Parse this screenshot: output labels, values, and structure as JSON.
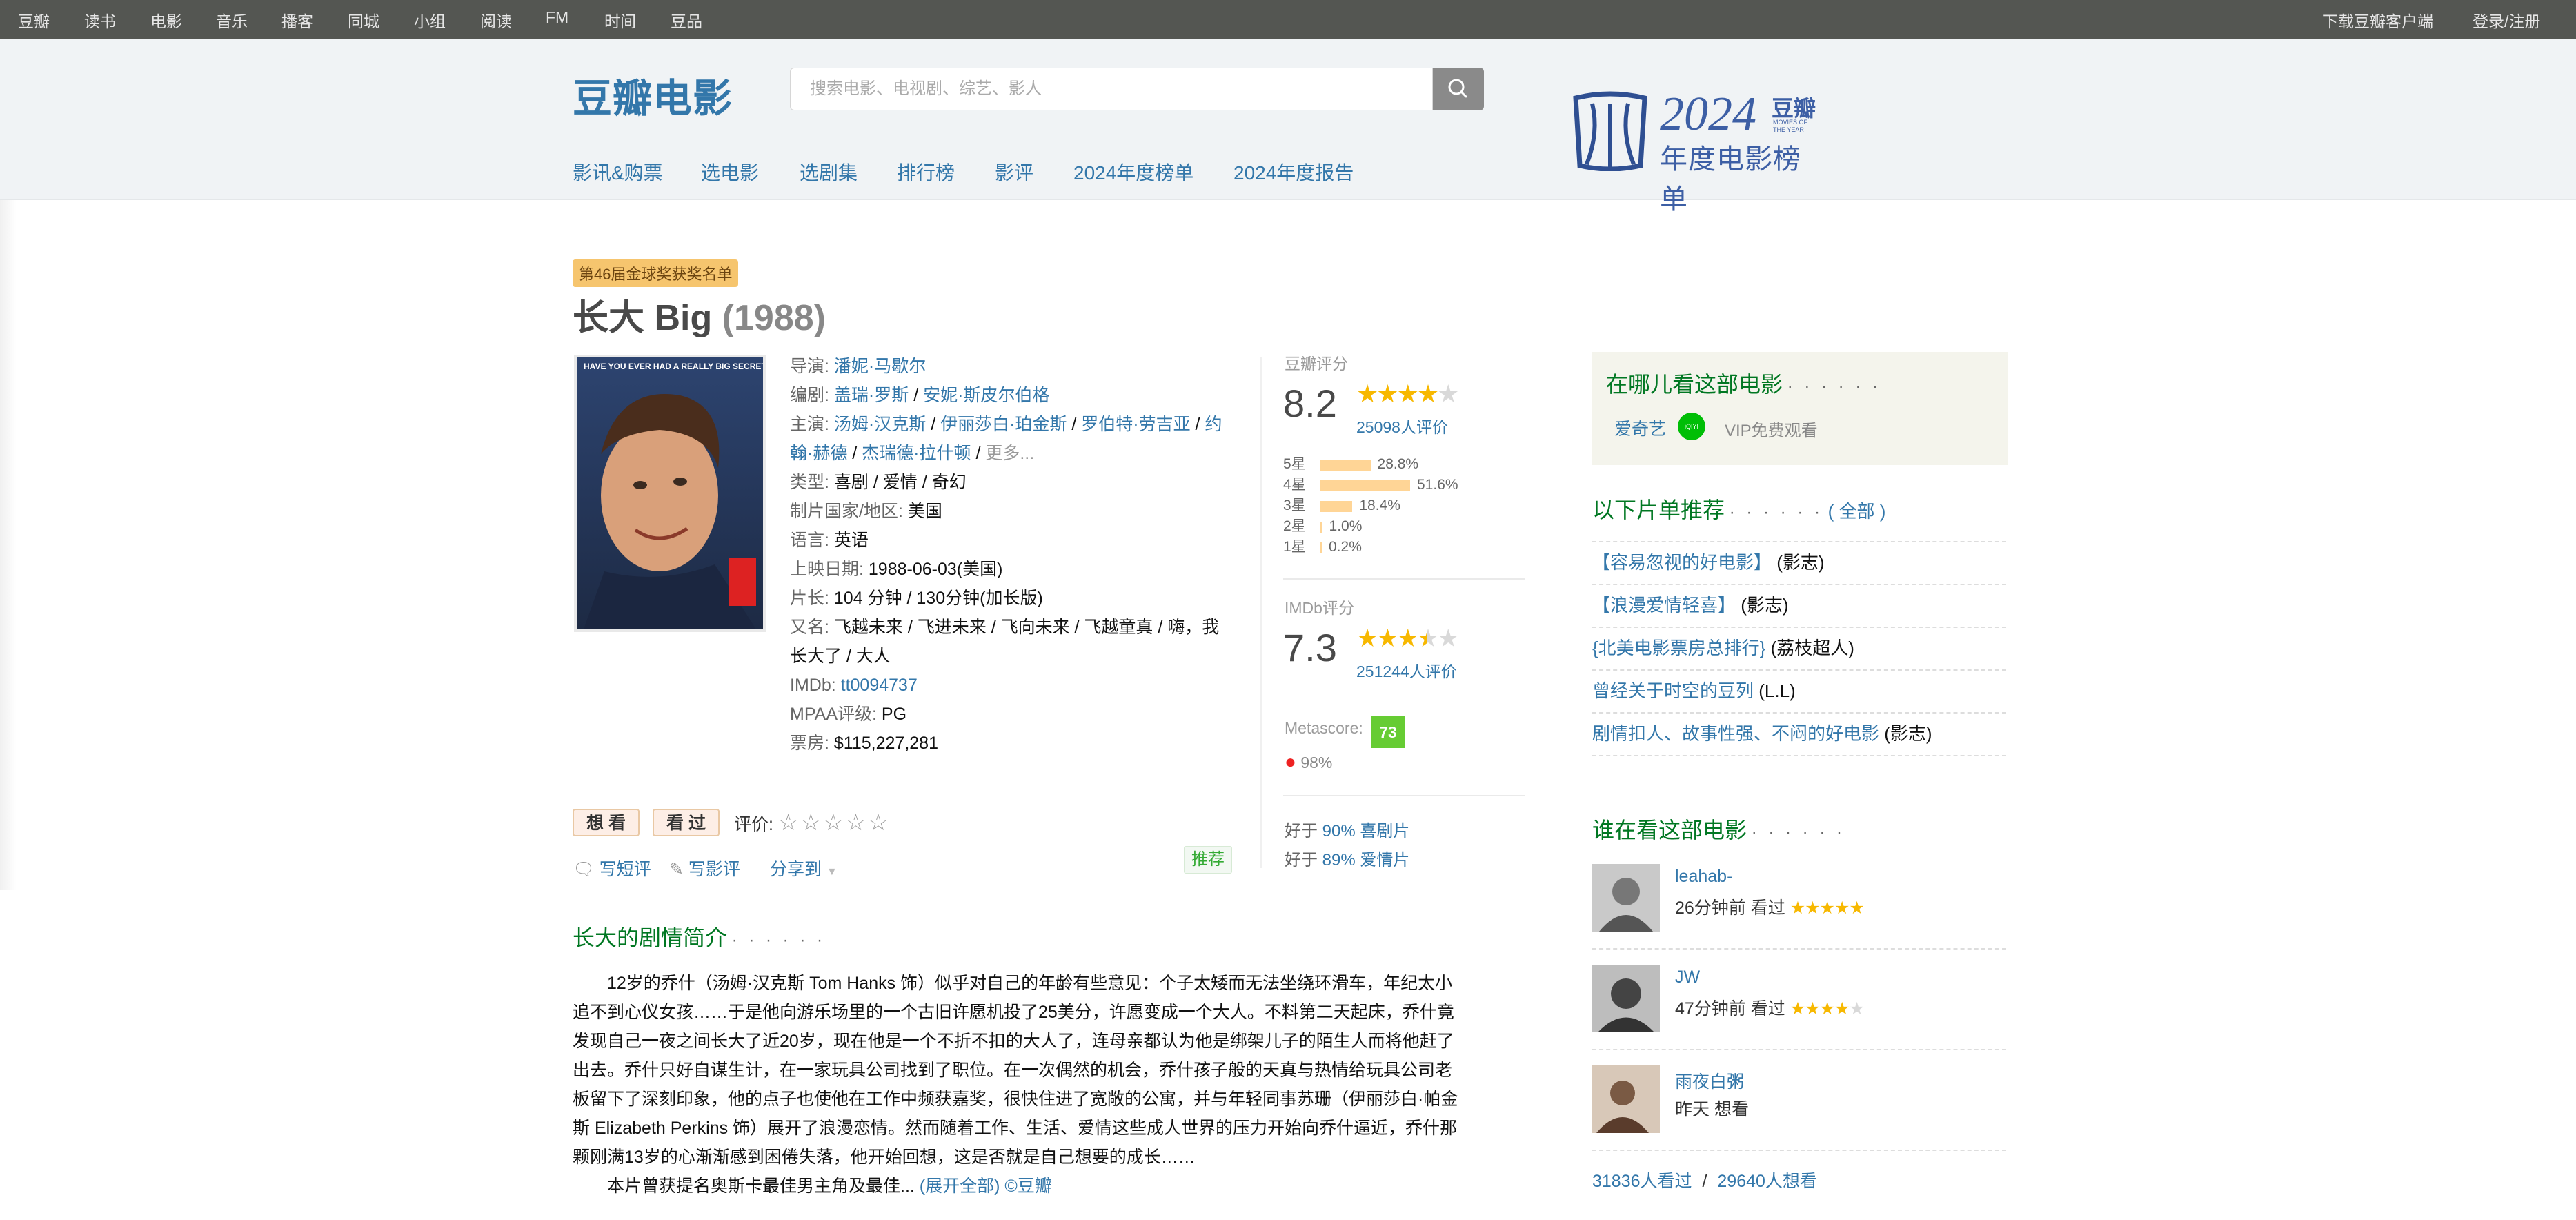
{
  "topbar": {
    "left_items": [
      "豆瓣",
      "读书",
      "电影",
      "音乐",
      "播客",
      "同城",
      "小组",
      "阅读",
      "FM",
      "时间",
      "豆品"
    ],
    "right_items": [
      "下载豆瓣客户端",
      "登录/注册"
    ]
  },
  "header": {
    "logo": "豆瓣电影",
    "search_placeholder": "搜索电影、电视剧、综艺、影人",
    "nav": [
      "影讯&购票",
      "选电影",
      "选剧集",
      "排行榜",
      "影评",
      "2024年度榜单",
      "2024年度报告"
    ],
    "promo": {
      "year": "2024",
      "brand": "豆瓣",
      "sub": "MOVIES OF THE YEAR",
      "caption": "年度电影榜单"
    }
  },
  "movie": {
    "award_badge": "第46届金球奖获奖名单",
    "title": "长大 Big",
    "year": "(1988)",
    "poster_caption": "HAVE YOU EVER HAD A REALLY BIG SECRET?",
    "info": {
      "director_label": "导演",
      "director": "潘妮·马歇尔",
      "writer_label": "编剧",
      "writers": [
        "盖瑞·罗斯",
        "安妮·斯皮尔伯格"
      ],
      "cast_label": "主演",
      "cast_line1": [
        "汤姆·汉克斯",
        "伊丽莎白·珀金斯",
        "罗伯特·劳吉亚",
        "约"
      ],
      "cast_line2": [
        "翰·赫德",
        "杰瑞德·拉什顿"
      ],
      "cast_more": "更多...",
      "genre_label": "类型:",
      "genre": "喜剧 / 爱情 / 奇幻",
      "country_label": "制片国家/地区:",
      "country": "美国",
      "language_label": "语言:",
      "language": "英语",
      "release_label": "上映日期:",
      "release": "1988-06-03(美国)",
      "runtime_label": "片长:",
      "runtime": "104 分钟 / 130分钟(加长版)",
      "aka_label": "又名:",
      "aka_line1": "飞越未来 / 飞进未来 / 飞向未来 / 飞越童真 / 嗨，我",
      "aka_line2": "长大了 / 大人",
      "imdb_label": "IMDb:",
      "imdb": "tt0094737",
      "mpaa_label": "MPAA评级:",
      "mpaa": "PG",
      "boxoffice_label": "票房:",
      "boxoffice": "$115,227,281"
    }
  },
  "rating": {
    "label": "豆瓣评分",
    "score": "8.2",
    "stars": 4,
    "count": "25098人评价",
    "histogram": [
      {
        "label": "5星",
        "pct": "28.8%",
        "value": 28.8
      },
      {
        "label": "4星",
        "pct": "51.6%",
        "value": 51.6
      },
      {
        "label": "3星",
        "pct": "18.4%",
        "value": 18.4
      },
      {
        "label": "2星",
        "pct": "1.0%",
        "value": 1.0
      },
      {
        "label": "1星",
        "pct": "0.2%",
        "value": 0.2
      }
    ],
    "imdb_label": "IMDb评分",
    "imdb_score": "7.3",
    "imdb_stars": 3.5,
    "imdb_count": "251244人评价",
    "metascore_label": "Metascore:",
    "metascore": "73",
    "tomato": "98%",
    "better1_pre": "好于",
    "better1_pct": "90%",
    "better1_genre": "喜剧片",
    "better2_pre": "好于",
    "better2_pct": "89%",
    "better2_genre": "爱情片"
  },
  "actions": {
    "want": "想 看",
    "seen": "看 过",
    "rate_label": "评价:",
    "short_review": "写短评",
    "review": "写影评",
    "share": "分享到",
    "recommend": "推荐"
  },
  "synopsis": {
    "heading": "长大的剧情简介",
    "dots": "· · · · · ·",
    "lines": [
      "12岁的乔什（汤姆·汉克斯 Tom Hanks 饰）似乎对自己的年龄有些意见：个子太矮而无法坐绕环滑车，年纪太小",
      "追不到心仪女孩……于是他向游乐场里的一个古旧许愿机投了25美分，许愿变成一个大人。不料第二天起床，乔什竟",
      "发现自己一夜之间长大了近20岁，现在他是一个不折不扣的大人了，连母亲都认为他是绑架儿子的陌生人而将他赶了",
      "出去。乔什只好自谋生计，在一家玩具公司找到了职位。在一次偶然的机会，乔什孩子般的天真与热情给玩具公司老",
      "板留下了深刻印象，他的点子也使他在工作中频获嘉奖，很快住进了宽敞的公寓，并与年轻同事苏珊（伊丽莎白·帕金",
      "斯 Elizabeth Perkins 饰）展开了浪漫恋情。然而随着工作、生活、爱情这些成人世界的压力开始向乔什逼近，乔什那",
      "颗刚满13岁的心渐渐感到困倦失落，他开始回想，这是否就是自己想要的成长……"
    ],
    "last_line": "本片曾获提名奥斯卡最佳男主角及最佳...",
    "expand": "(展开全部)",
    "copyright": "©豆瓣"
  },
  "where": {
    "heading": "在哪儿看这部电影",
    "dots": "· · · · · ·",
    "platform": "爱奇艺",
    "badge": "iQIYI",
    "vip": "VIP免费观看"
  },
  "lists": {
    "heading": "以下片单推荐",
    "dots": "· · · · · ·",
    "all": "( 全部 )",
    "items": [
      {
        "title": "【容易忽视的好电影】",
        "author": "(影志)"
      },
      {
        "title": "【浪漫爱情轻喜】",
        "author": "(影志)"
      },
      {
        "title": "{北美电影票房总排行}",
        "author": "(荔枝超人)"
      },
      {
        "title": "曾经关于时空的豆列",
        "author": "(L.L)"
      },
      {
        "title": "剧情扣人、故事性强、不闷的好电影",
        "author": "(影志)"
      }
    ]
  },
  "watchers": {
    "heading": "谁在看这部电影",
    "dots": "· · · · · ·",
    "items": [
      {
        "name": "leahab-",
        "time": "26分钟前",
        "action": "看过",
        "stars": 5
      },
      {
        "name": "JW",
        "time": "47分钟前",
        "action": "看过",
        "stars": 4
      },
      {
        "name": "雨夜白粥",
        "time": "昨天",
        "action": "想看",
        "stars": 0
      }
    ],
    "seen_count": "31836人看过",
    "slash": "/",
    "want_count": "29640人想看"
  },
  "colors": {
    "link": "#3377aa",
    "green_heading": "#007722",
    "star": "#f7b800",
    "topbar": "#545652"
  }
}
